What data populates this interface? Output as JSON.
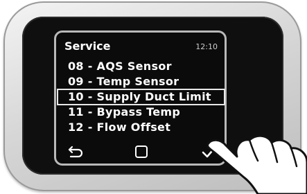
{
  "screen": {
    "title": "Service",
    "time": "12:10",
    "items": [
      {
        "label": "08 - AQS Sensor",
        "selected": false
      },
      {
        "label": "09 - Temp Sensor",
        "selected": false
      },
      {
        "label": "10 - Supply Duct Limit",
        "selected": true
      },
      {
        "label": "11 - Bypass Temp",
        "selected": false
      },
      {
        "label": "12 - Flow Offset",
        "selected": false
      }
    ]
  },
  "nav": {
    "back_icon": "back-arrow-icon",
    "home_icon": "square-home-icon",
    "confirm_icon": "checkmark-icon"
  },
  "colors": {
    "screen_bg": "#0b0b0b",
    "text": "#ffffff",
    "bezel": "#d7d7d7"
  }
}
